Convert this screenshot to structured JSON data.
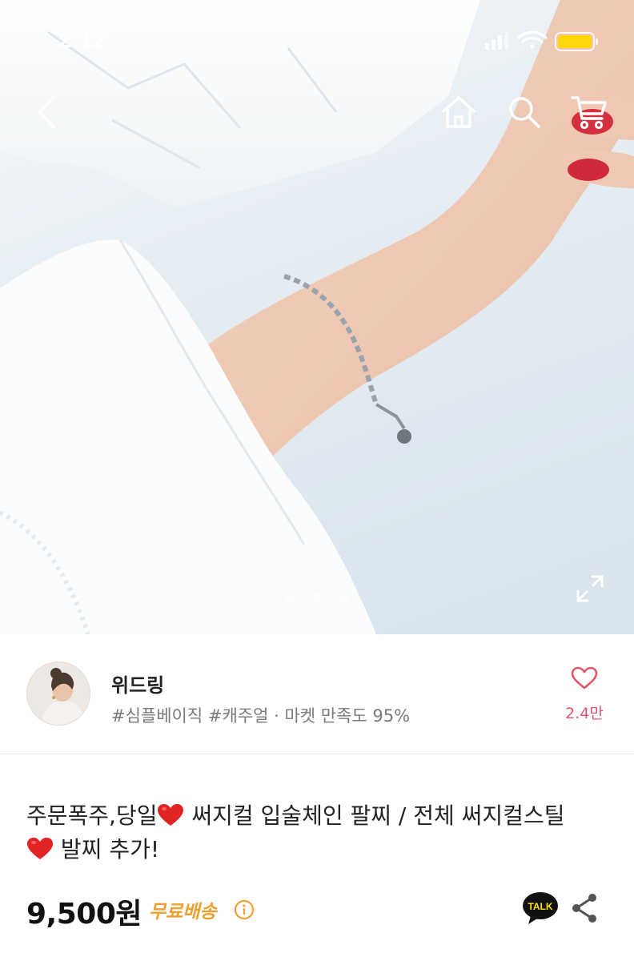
{
  "status_bar": {
    "time": "2:12",
    "icons": [
      "signal-icon",
      "wifi-icon",
      "battery-icon"
    ]
  },
  "nav": {
    "icons": [
      "back-icon",
      "home-icon",
      "search-icon",
      "cart-icon"
    ]
  },
  "gallery": {
    "image": "wrist-with-silver-chain-bracelet",
    "pager": {
      "current": 2,
      "total": 3
    },
    "expand_icon": "expand-icon"
  },
  "seller": {
    "name": "위드링",
    "tags": "#심플베이직 #캐주얼 · 마켓 만족도 95%",
    "like_count": "2.4만",
    "like_icon": "heart-outline-icon"
  },
  "product": {
    "title_part1": "주문폭주,당일",
    "title_part2": " 써지컬 입술체인 팔찌 / 전체 써지컬스틸",
    "title_part3": " 발찌 추가!",
    "price": "9,500원",
    "shipping": "무료배송",
    "info_icon": "info-icon",
    "talk_label": "TALK",
    "share_icon": "share-icon"
  },
  "colors": {
    "accent_pink": "#e0576b",
    "shipping_orange": "#f0a030",
    "talk_yellow": "#fae100",
    "battery_yellow": "#ffd60a"
  }
}
